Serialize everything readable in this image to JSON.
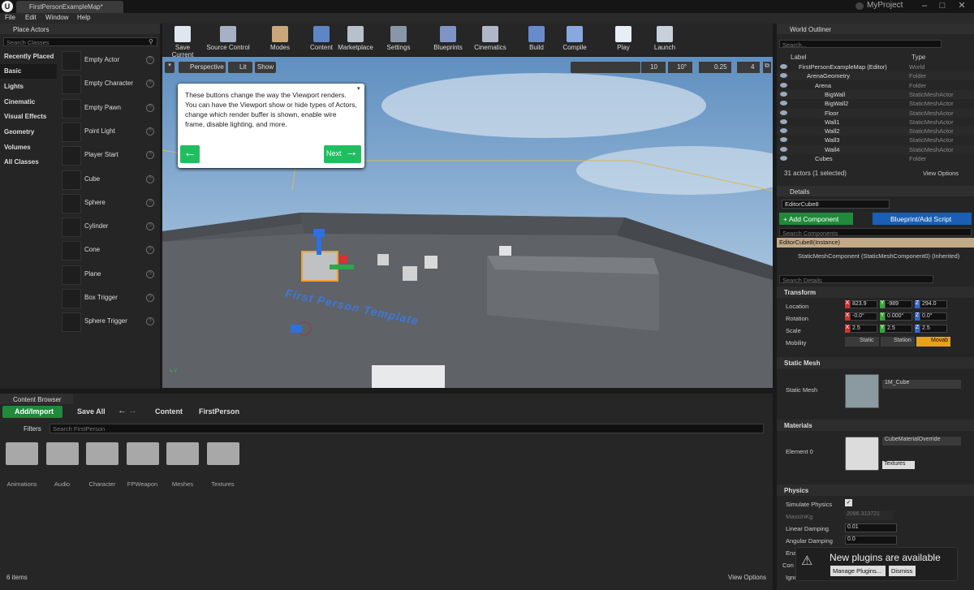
{
  "window": {
    "tab": "FirstPersonExampleMap*",
    "project": "MyProject",
    "logo": "U"
  },
  "menu": [
    "File",
    "Edit",
    "Window",
    "Help"
  ],
  "place_actors": {
    "title": "Place Actors",
    "search_placeholder": "Search Classes",
    "categories": [
      "Recently Placed",
      "Basic",
      "Lights",
      "Cinematic",
      "Visual Effects",
      "Geometry",
      "Volumes",
      "All Classes"
    ],
    "items": [
      "Empty Actor",
      "Empty Character",
      "Empty Pawn",
      "Point Light",
      "Player Start",
      "Cube",
      "Sphere",
      "Cylinder",
      "Cone",
      "Plane",
      "Box Trigger",
      "Sphere Trigger"
    ]
  },
  "toolbar": [
    "Save Current",
    "Source Control",
    "Modes",
    "Content",
    "Marketplace",
    "Settings",
    "Blueprints",
    "Cinematics",
    "Build",
    "Compile",
    "Play",
    "Launch"
  ],
  "viewport": {
    "perspective": "Perspective",
    "lit": "Lit",
    "show": "Show",
    "grid": "10",
    "angle": "10°",
    "scale": "0.25",
    "cams": "4",
    "tip": "These buttons change the way the Viewport renders. You can have the Viewport show or hide types of Actors, change which render buffer is shown, enable wire frame, disable lighting, and more.",
    "next": "Next",
    "floor_text": "First Person Template"
  },
  "content_browser": {
    "title": "Content Browser",
    "add": "Add/Import",
    "save": "Save All",
    "path": [
      "Content",
      "FirstPerson"
    ],
    "filters": "Filters",
    "search": "Search FirstPerson",
    "folders": [
      "Animations",
      "Audio",
      "Character",
      "FPWeapon",
      "Meshes",
      "Textures"
    ],
    "count": "6 items",
    "view": "View Options"
  },
  "outliner": {
    "title": "World Outliner",
    "search": "Search...",
    "col_label": "Label",
    "col_type": "Type",
    "rows": [
      [
        "FirstPersonExampleMap (Editor)",
        "World"
      ],
      [
        "ArenaGeometry",
        "Folder"
      ],
      [
        "Arena",
        "Folder"
      ],
      [
        "BigWall",
        "StaticMeshActor"
      ],
      [
        "BigWall2",
        "StaticMeshActor"
      ],
      [
        "Floor",
        "StaticMeshActor"
      ],
      [
        "Wall1",
        "StaticMeshActor"
      ],
      [
        "Wall2",
        "StaticMeshActor"
      ],
      [
        "Wall3",
        "StaticMeshActor"
      ],
      [
        "Wall4",
        "StaticMeshActor"
      ],
      [
        "Cubes",
        "Folder"
      ]
    ],
    "status": "31 actors (1 selected)",
    "view": "View Options"
  },
  "details": {
    "title": "Details",
    "name": "EditorCube8",
    "add": "+ Add Component",
    "bp": "Blueprint/Add Script",
    "search_comp": "Search Components",
    "inst": "EditorCube8(Instance)",
    "comp": "StaticMeshComponent (StaticMeshComponent0) (Inherited)",
    "search": "Search Details",
    "transform": "Transform",
    "location": "Location",
    "rotation": "Rotation",
    "scale": "Scale",
    "mobility": "Mobility",
    "loc": [
      "823.9",
      "-989",
      "294.0"
    ],
    "rot": [
      "-0.0°",
      "0.000°",
      "0.0°"
    ],
    "scl": [
      "2.5",
      "2.5",
      "2.5"
    ],
    "mob": [
      "Static",
      "Station",
      "Movab"
    ],
    "sm_section": "Static Mesh",
    "sm_label": "Static Mesh",
    "sm_value": "1M_Cube",
    "mat_section": "Materials",
    "mat_label": "Element 0",
    "mat_value": "CubeMaterialOverride",
    "mat_tex": "Textures",
    "phys": "Physics",
    "sim": "Simulate Physics",
    "mass": "MassInKg",
    "mass_val": "2096.313721",
    "lin": "Linear Damping",
    "lin_val": "0.01",
    "ang": "Angular Damping",
    "ang_val": "0.0",
    "ena": "Enal",
    "con": "Con",
    "ign": "Igno"
  },
  "notify": {
    "title": "New plugins are available",
    "manage": "Manage Plugins...",
    "dismiss": "Dismiss"
  }
}
